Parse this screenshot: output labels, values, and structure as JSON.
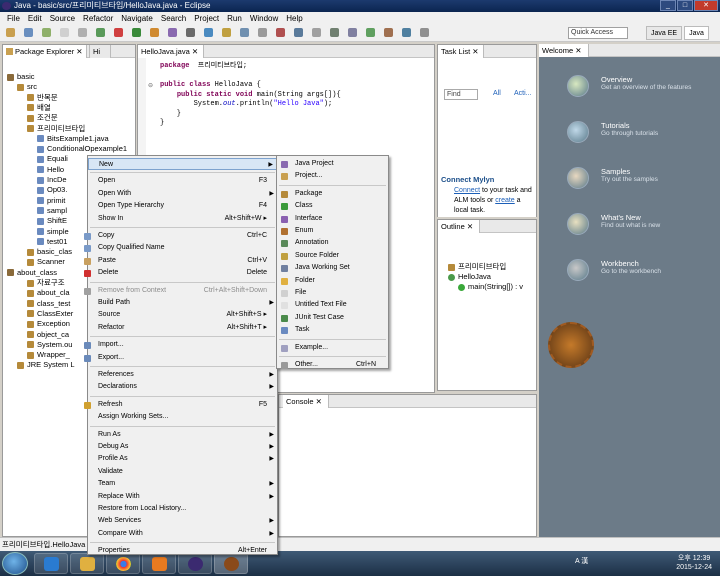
{
  "window": {
    "title": "Java - basic/src/프리미티브타입/HelloJava.java - Eclipse"
  },
  "menubar": [
    "File",
    "Edit",
    "Source",
    "Refactor",
    "Navigate",
    "Search",
    "Project",
    "Run",
    "Window",
    "Help"
  ],
  "toolbar": {
    "quick_access_placeholder": "Quick Access",
    "perspectives": [
      "Java EE",
      "Java"
    ]
  },
  "package_explorer": {
    "tab_label": "Package Explorer",
    "tab2_label": "Hi",
    "tree": [
      {
        "label": "basic",
        "depth": 0
      },
      {
        "label": "src",
        "depth": 1
      },
      {
        "label": "반복문",
        "depth": 2
      },
      {
        "label": "배열",
        "depth": 2
      },
      {
        "label": "조건문",
        "depth": 2
      },
      {
        "label": "프리미티브타입",
        "depth": 2
      },
      {
        "label": "BitsExample1.java",
        "depth": 3
      },
      {
        "label": "ConditionalOpexample1",
        "depth": 3
      },
      {
        "label": "Equali",
        "depth": 3
      },
      {
        "label": "Hello",
        "depth": 3
      },
      {
        "label": "IncDe",
        "depth": 3
      },
      {
        "label": "Op03.",
        "depth": 3
      },
      {
        "label": "primit",
        "depth": 3
      },
      {
        "label": "sampl",
        "depth": 3
      },
      {
        "label": "ShiftE",
        "depth": 3
      },
      {
        "label": "simple",
        "depth": 3
      },
      {
        "label": "test01",
        "depth": 3
      },
      {
        "label": "basic_clas",
        "depth": 2
      },
      {
        "label": "Scanner",
        "depth": 2
      },
      {
        "label": "about_class",
        "depth": 0
      },
      {
        "label": "자료구조",
        "depth": 2
      },
      {
        "label": "about_cla",
        "depth": 2
      },
      {
        "label": "class_test",
        "depth": 2
      },
      {
        "label": "ClassExter",
        "depth": 2
      },
      {
        "label": "Exception",
        "depth": 2
      },
      {
        "label": "object_ca",
        "depth": 2
      },
      {
        "label": "System.ou",
        "depth": 2
      },
      {
        "label": "Wrapper_",
        "depth": 2
      },
      {
        "label": "JRE System L",
        "depth": 1
      }
    ]
  },
  "editor": {
    "tab_label": "HelloJava.java",
    "lines": [
      {
        "parts": [
          [
            "kw",
            "package"
          ],
          [
            "",
            "  프리미티브타입;"
          ]
        ]
      },
      {
        "parts": [
          [
            "",
            ""
          ]
        ]
      },
      {
        "parts": [
          [
            "kw",
            "public class"
          ],
          [
            "",
            " HelloJava {"
          ]
        ]
      },
      {
        "parts": [
          [
            "",
            "    "
          ],
          [
            "kw",
            "public static void"
          ],
          [
            "",
            " main(String args[]){"
          ]
        ]
      },
      {
        "parts": [
          [
            "",
            "        System."
          ],
          [
            "fld",
            "out"
          ],
          [
            "",
            ".println("
          ],
          [
            "str",
            "\"Hello Java\""
          ],
          [
            "",
            ");"
          ]
        ]
      },
      {
        "parts": [
          [
            "",
            "    }"
          ]
        ]
      },
      {
        "parts": [
          [
            "",
            "}"
          ]
        ]
      }
    ]
  },
  "context_menu": [
    {
      "label": "New",
      "shortcut": "",
      "submenu": true,
      "highlight": true
    },
    {
      "sep": true
    },
    {
      "label": "Open",
      "shortcut": "F3"
    },
    {
      "label": "Open With",
      "submenu": true
    },
    {
      "label": "Open Type Hierarchy",
      "shortcut": "F4"
    },
    {
      "label": "Show In",
      "shortcut": "Alt+Shift+W ▸"
    },
    {
      "sep": true
    },
    {
      "label": "Copy",
      "shortcut": "Ctrl+C",
      "icon": "copy-icon"
    },
    {
      "label": "Copy Qualified Name",
      "icon": "copy-icon"
    },
    {
      "label": "Paste",
      "shortcut": "Ctrl+V",
      "icon": "paste-icon"
    },
    {
      "label": "Delete",
      "shortcut": "Delete",
      "icon": "delete-icon"
    },
    {
      "sep": true
    },
    {
      "label": "Remove from Context",
      "shortcut": "Ctrl+Alt+Shift+Down",
      "disabled": true,
      "icon": "remove-icon"
    },
    {
      "label": "Build Path",
      "submenu": true
    },
    {
      "label": "Source",
      "shortcut": "Alt+Shift+S ▸"
    },
    {
      "label": "Refactor",
      "shortcut": "Alt+Shift+T ▸"
    },
    {
      "sep": true
    },
    {
      "label": "Import...",
      "icon": "import-icon"
    },
    {
      "label": "Export...",
      "icon": "export-icon"
    },
    {
      "sep": true
    },
    {
      "label": "References",
      "submenu": true
    },
    {
      "label": "Declarations",
      "submenu": true
    },
    {
      "sep": true
    },
    {
      "label": "Refresh",
      "shortcut": "F5",
      "icon": "refresh-icon"
    },
    {
      "label": "Assign Working Sets..."
    },
    {
      "sep": true
    },
    {
      "label": "Run As",
      "submenu": true
    },
    {
      "label": "Debug As",
      "submenu": true
    },
    {
      "label": "Profile As",
      "submenu": true
    },
    {
      "label": "Validate"
    },
    {
      "label": "Team",
      "submenu": true
    },
    {
      "label": "Replace With",
      "submenu": true
    },
    {
      "label": "Restore from Local History..."
    },
    {
      "label": "Web Services",
      "submenu": true
    },
    {
      "label": "Compare With",
      "submenu": true
    },
    {
      "sep": true
    },
    {
      "label": "Properties",
      "shortcut": "Alt+Enter"
    }
  ],
  "submenu": [
    {
      "label": "Java Project",
      "icon": "java-project-icon"
    },
    {
      "label": "Project...",
      "icon": "project-icon"
    },
    {
      "sep": true
    },
    {
      "label": "Package",
      "icon": "package-icon"
    },
    {
      "label": "Class",
      "icon": "class-icon"
    },
    {
      "label": "Interface",
      "icon": "interface-icon"
    },
    {
      "label": "Enum",
      "icon": "enum-icon"
    },
    {
      "label": "Annotation",
      "icon": "annotation-icon"
    },
    {
      "label": "Source Folder",
      "icon": "source-folder-icon"
    },
    {
      "label": "Java Working Set",
      "icon": "working-set-icon"
    },
    {
      "label": "Folder",
      "icon": "folder-icon"
    },
    {
      "label": "File",
      "icon": "file-icon"
    },
    {
      "label": "Untitled Text File",
      "icon": "text-file-icon"
    },
    {
      "label": "JUnit Test Case",
      "icon": "junit-icon"
    },
    {
      "label": "Task",
      "icon": "task-icon"
    },
    {
      "sep": true
    },
    {
      "label": "Example...",
      "icon": "example-icon"
    },
    {
      "sep": true
    },
    {
      "label": "Other...",
      "shortcut": "Ctrl+N",
      "icon": "other-icon"
    }
  ],
  "task_list": {
    "tab_label": "Task List",
    "find_placeholder": "Find",
    "all_label": "All",
    "acti_label": "Acti..."
  },
  "mylyn": {
    "title": "Connect Mylyn",
    "text1_link": "Connect",
    "text1_rest": " to your task and",
    "text2_pre": "ALM tools or ",
    "text2_link": "create",
    "text2_post": " a",
    "text3": "local task."
  },
  "outline": {
    "tab_label": "Outline",
    "items": [
      "프리미티브타입",
      "HelloJava",
      "main(String[]) : v"
    ]
  },
  "console": {
    "tab_label": "Console"
  },
  "welcome": {
    "tab_label": "Welcome",
    "items": [
      {
        "title": "Overview",
        "desc": "Get an overview of the features"
      },
      {
        "title": "Tutorials",
        "desc": "Go through tutorials"
      },
      {
        "title": "Samples",
        "desc": "Try out the samples"
      },
      {
        "title": "What's New",
        "desc": "Find out what is new"
      },
      {
        "title": "Workbench",
        "desc": "Go to the workbench"
      }
    ]
  },
  "statusbar": {
    "text": "프리미티브타입.HelloJava"
  },
  "taskbar": {
    "clock_time": "오후 12:39",
    "clock_date": "2015-12-24",
    "ime": "A 漢"
  }
}
